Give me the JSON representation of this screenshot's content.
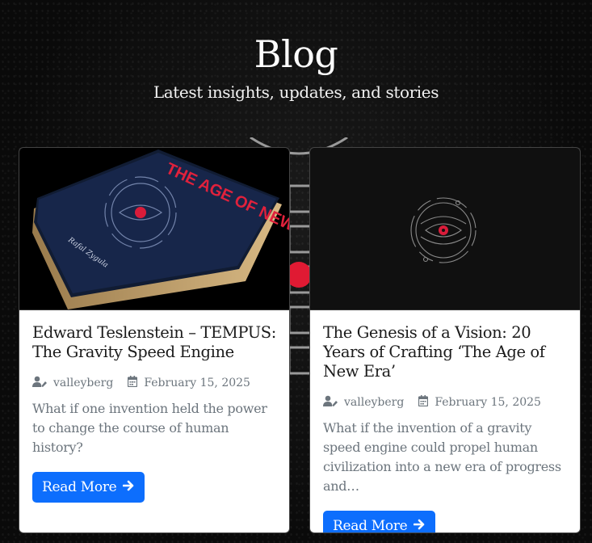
{
  "header": {
    "title": "Blog",
    "subtitle": "Latest insights, updates, and stories"
  },
  "posts": [
    {
      "title": "Edward Teslenstein – TEMPUS: The Gravity Speed Engine",
      "author": "valleyberg",
      "date": "February 15, 2025",
      "excerpt": "What if one invention held the power to change the course of human history?",
      "read_more": "Read More",
      "image": {
        "book_title": "THE AGE OF NEW ERA",
        "book_author": "Rafal Zygula"
      }
    },
    {
      "title": "The Genesis of a Vision: 20 Years of Crafting ‘The Age of New Era’",
      "author": "valleyberg",
      "date": "February 15, 2025",
      "excerpt": "What if the invention of a gravity speed engine could propel human civilization into a new era of progress and…",
      "read_more": "Read More"
    }
  ],
  "colors": {
    "accent": "#0d6efd",
    "eye_red": "#d91c3a",
    "muted_text": "#6c757d"
  },
  "icons": {
    "author": "user-pen-icon",
    "date": "calendar-icon",
    "read_more": "arrow-right-icon"
  }
}
